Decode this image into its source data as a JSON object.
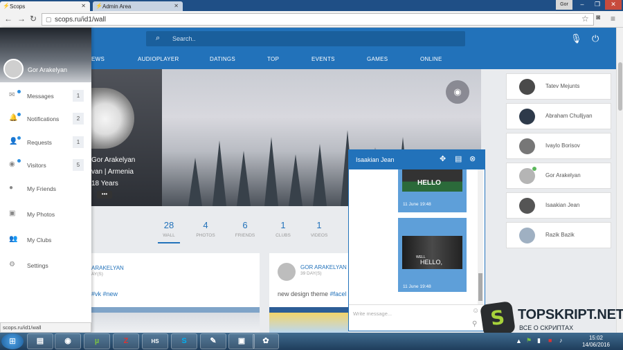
{
  "browser": {
    "tabs": [
      {
        "label": "Scops",
        "active": true
      },
      {
        "label": "Admin Area",
        "active": false
      }
    ],
    "url": "scops.ru/id1/wall",
    "window_user": "Gor"
  },
  "header": {
    "search_placeholder": "Search..",
    "menu": [
      "EWS",
      "AUDIOPLAYER",
      "DATINGS",
      "TOP",
      "EVENTS",
      "GAMES",
      "ONLINE"
    ]
  },
  "sidebar": {
    "user_name": "Gor Arakelyan",
    "items": [
      {
        "label": "Messages",
        "count": "1",
        "icon": "envelope-icon",
        "badge": true
      },
      {
        "label": "Notifications",
        "count": "2",
        "icon": "bell-icon",
        "badge": true
      },
      {
        "label": "Requests",
        "count": "1",
        "icon": "user-plus-icon",
        "badge": true
      },
      {
        "label": "Visitors",
        "count": "5",
        "icon": "eye-icon",
        "badge": true
      },
      {
        "label": "My Friends",
        "count": "",
        "icon": "user-icon",
        "badge": false
      },
      {
        "label": "My Photos",
        "count": "",
        "icon": "image-icon",
        "badge": false
      },
      {
        "label": "My Clubs",
        "count": "",
        "icon": "users-icon",
        "badge": false
      },
      {
        "label": "Settings",
        "count": "",
        "icon": "cogs-icon",
        "badge": false
      }
    ]
  },
  "profile": {
    "name": "Gor Arakelyan",
    "location": "van | Armenia",
    "age": "18 Years",
    "more": "•••"
  },
  "stats": [
    {
      "value": "28",
      "label": "WALL"
    },
    {
      "value": "4",
      "label": "PHOTOS"
    },
    {
      "value": "6",
      "label": "FRIENDS"
    },
    {
      "value": "1",
      "label": "CLUBS"
    },
    {
      "value": "1",
      "label": "VIDEOS"
    }
  ],
  "posts": [
    {
      "author": "ARAKELYAN",
      "date": "AY(S)",
      "text_tags": "#vk #new"
    },
    {
      "author": "GOR ARAKELYAN",
      "date": "39 DAY(S)",
      "text_plain": "new design theme ",
      "text_tags": "#facel"
    }
  ],
  "friends": [
    {
      "name": "Tatev Mejunts",
      "online": false
    },
    {
      "name": "Abraham Chulljyan",
      "online": false
    },
    {
      "name": "Ivaylo Borisov",
      "online": false
    },
    {
      "name": "Gor Arakelyan",
      "online": true
    },
    {
      "name": "Isaakian Jean",
      "online": false
    },
    {
      "name": "Razik Bazik",
      "online": false
    }
  ],
  "chat": {
    "title": "Isaakian Jean",
    "messages": [
      {
        "image_text": "HELLO",
        "time": "11 June 19:48"
      },
      {
        "image_text_top": "WELL",
        "image_text": "HELLO,",
        "time": "11 June 19:48"
      }
    ],
    "input_placeholder": "Write message..."
  },
  "status_url": "scops.ru/id1/wall",
  "watermark": {
    "title": "TOPSKRIPT.NET",
    "subtitle": "ВСЕ О СКРИПТАХ",
    "logo": "S"
  },
  "taskbar": {
    "apps": [
      "explorer",
      "chrome",
      "utorrent",
      "filezilla",
      "hotspot-shield",
      "skype",
      "notepad",
      "media",
      "paint"
    ],
    "time": "15:02",
    "date": "14/06/2016"
  },
  "colors": {
    "accent": "#2272ba",
    "chat_bubble": "#5e9fd9",
    "online": "#5cb85c",
    "watermark_green": "#a7d23b"
  }
}
